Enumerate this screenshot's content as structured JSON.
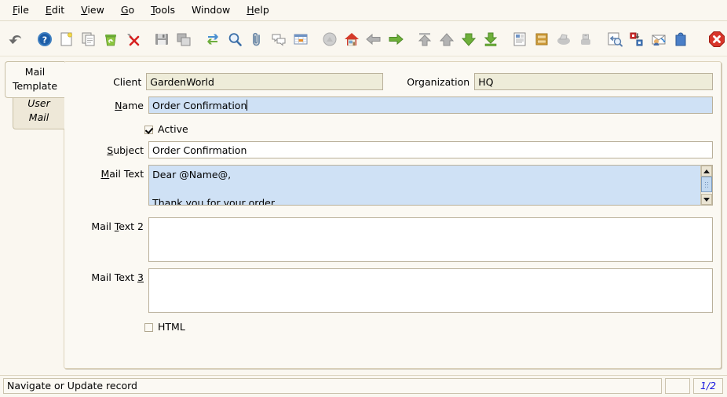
{
  "window": {
    "status_message": "Navigate or Update record",
    "record_counter": "1/2"
  },
  "menubar": {
    "items": [
      {
        "label": "File",
        "mnemonic": "F"
      },
      {
        "label": "Edit",
        "mnemonic": "E"
      },
      {
        "label": "View",
        "mnemonic": "V"
      },
      {
        "label": "Go",
        "mnemonic": "G"
      },
      {
        "label": "Tools",
        "mnemonic": "T"
      },
      {
        "label": "Window",
        "mnemonic": ""
      },
      {
        "label": "Help",
        "mnemonic": "H"
      }
    ]
  },
  "toolbar": {
    "buttons": [
      {
        "name": "undo-icon",
        "title": "Undo"
      },
      {
        "name": "help-icon",
        "title": "Help"
      },
      {
        "name": "new-record-icon",
        "title": "New"
      },
      {
        "name": "copy-record-icon",
        "title": "Copy"
      },
      {
        "name": "delete-recycle-icon",
        "title": "Delete"
      },
      {
        "name": "delete-selection-icon",
        "title": "Delete Selection"
      },
      {
        "name": "save-icon",
        "title": "Save"
      },
      {
        "name": "save-create-icon",
        "title": "Save and Create"
      },
      {
        "name": "refresh-icon",
        "title": "Refresh"
      },
      {
        "name": "find-icon",
        "title": "Find"
      },
      {
        "name": "attachment-icon",
        "title": "Attachment"
      },
      {
        "name": "chat-icon",
        "title": "Chat"
      },
      {
        "name": "grid-toggle-icon",
        "title": "Grid Toggle"
      },
      {
        "name": "history-icon",
        "title": "History"
      },
      {
        "name": "home-icon",
        "title": "Home"
      },
      {
        "name": "previous-record-icon",
        "title": "Previous"
      },
      {
        "name": "next-record-icon",
        "title": "Next"
      },
      {
        "name": "first-record-icon",
        "title": "First"
      },
      {
        "name": "parent-record-icon",
        "title": "Parent"
      },
      {
        "name": "detail-record-icon",
        "title": "Detail"
      },
      {
        "name": "last-record-icon",
        "title": "Last"
      },
      {
        "name": "report-icon",
        "title": "Report"
      },
      {
        "name": "archive-icon",
        "title": "Archive"
      },
      {
        "name": "print-preview-icon",
        "title": "Print Preview"
      },
      {
        "name": "print-icon",
        "title": "Print"
      },
      {
        "name": "zoom-across-icon",
        "title": "Zoom Across"
      },
      {
        "name": "export-icon",
        "title": "Export"
      },
      {
        "name": "email-icon",
        "title": "Send Mail"
      },
      {
        "name": "lock-icon",
        "title": "Lock"
      },
      {
        "name": "close-window-icon",
        "title": "Close"
      }
    ]
  },
  "tabs": [
    {
      "label": "Mail Template",
      "selected": true
    },
    {
      "label": "User Mail",
      "selected": false
    }
  ],
  "form": {
    "client": {
      "label": "Client",
      "value": "GardenWorld",
      "readonly": true
    },
    "organization": {
      "label": "Organization",
      "value": "HQ",
      "readonly": true
    },
    "name": {
      "label": "Name",
      "mnemonic": "N",
      "value": "Order Confirmation",
      "focused": true
    },
    "active": {
      "label": "Active",
      "checked": true
    },
    "subject": {
      "label": "Subject",
      "mnemonic": "S",
      "value": "Order Confirmation"
    },
    "mail_text": {
      "label": "Mail Text",
      "mnemonic": "M",
      "value": "Dear @Name@,\n\nThank you for your order.",
      "focused": true
    },
    "mail_text_2": {
      "label": "Mail Text 2",
      "mnemonic": "T",
      "value": ""
    },
    "mail_text_3": {
      "label": "Mail Text 3",
      "mnemonic": "3",
      "value": ""
    },
    "html": {
      "label": "HTML",
      "checked": false
    }
  },
  "colors": {
    "window_bg": "#faf7f0",
    "panel_bg": "#fbf9f3",
    "readonly_field": "#eeecd9",
    "focused_field": "#cfe1f5",
    "border": "#b9b09a",
    "counter_text": "#1a1ae0"
  }
}
